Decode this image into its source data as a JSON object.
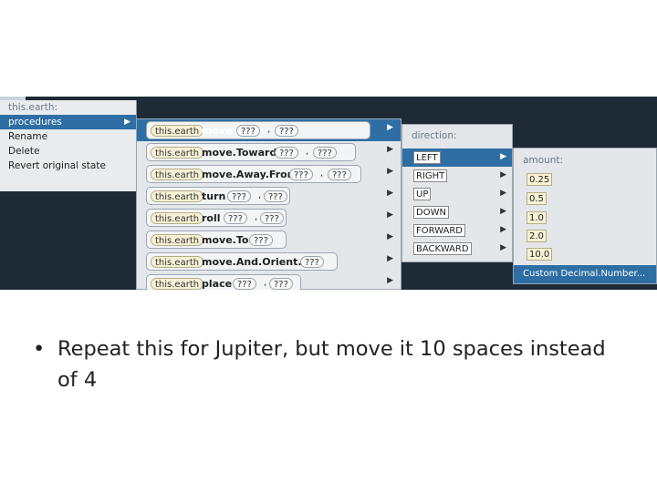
{
  "context_menu": {
    "title": "this.earth:",
    "items": [
      {
        "label": "procedures"
      },
      {
        "label": "Rename"
      },
      {
        "label": "Delete"
      },
      {
        "label": "Revert original state"
      }
    ]
  },
  "procedures_menu": {
    "rows": [
      {
        "object": "this.earth",
        "name": "move",
        "params": [
          "???",
          "???"
        ]
      },
      {
        "object": "this.earth",
        "name": "move.Toward",
        "params": [
          "???",
          "???"
        ]
      },
      {
        "object": "this.earth",
        "name": "move.Away.From",
        "params": [
          "???",
          "???"
        ]
      },
      {
        "object": "this.earth",
        "name": "turn",
        "params": [
          "???",
          "???"
        ]
      },
      {
        "object": "this.earth",
        "name": "roll",
        "params": [
          "???",
          "???"
        ]
      },
      {
        "object": "this.earth",
        "name": "move.To",
        "params": [
          "???"
        ]
      },
      {
        "object": "this.earth",
        "name": "move.And.Orient.To",
        "params": [
          "???"
        ]
      },
      {
        "object": "this.earth",
        "name": "place",
        "params": [
          "???",
          "???"
        ]
      }
    ]
  },
  "direction_menu": {
    "title": "direction:",
    "items": [
      "LEFT",
      "RIGHT",
      "UP",
      "DOWN",
      "FORWARD",
      "BACKWARD"
    ]
  },
  "amount_menu": {
    "title": "amount:",
    "items": [
      "0.25",
      "0.5",
      "1.0",
      "2.0",
      "10.0"
    ],
    "custom": "Custom Decimal.Number..."
  },
  "bullet": {
    "symbol": "•",
    "text": "Repeat this for Jupiter, but move it 10 spaces instead of 4"
  }
}
